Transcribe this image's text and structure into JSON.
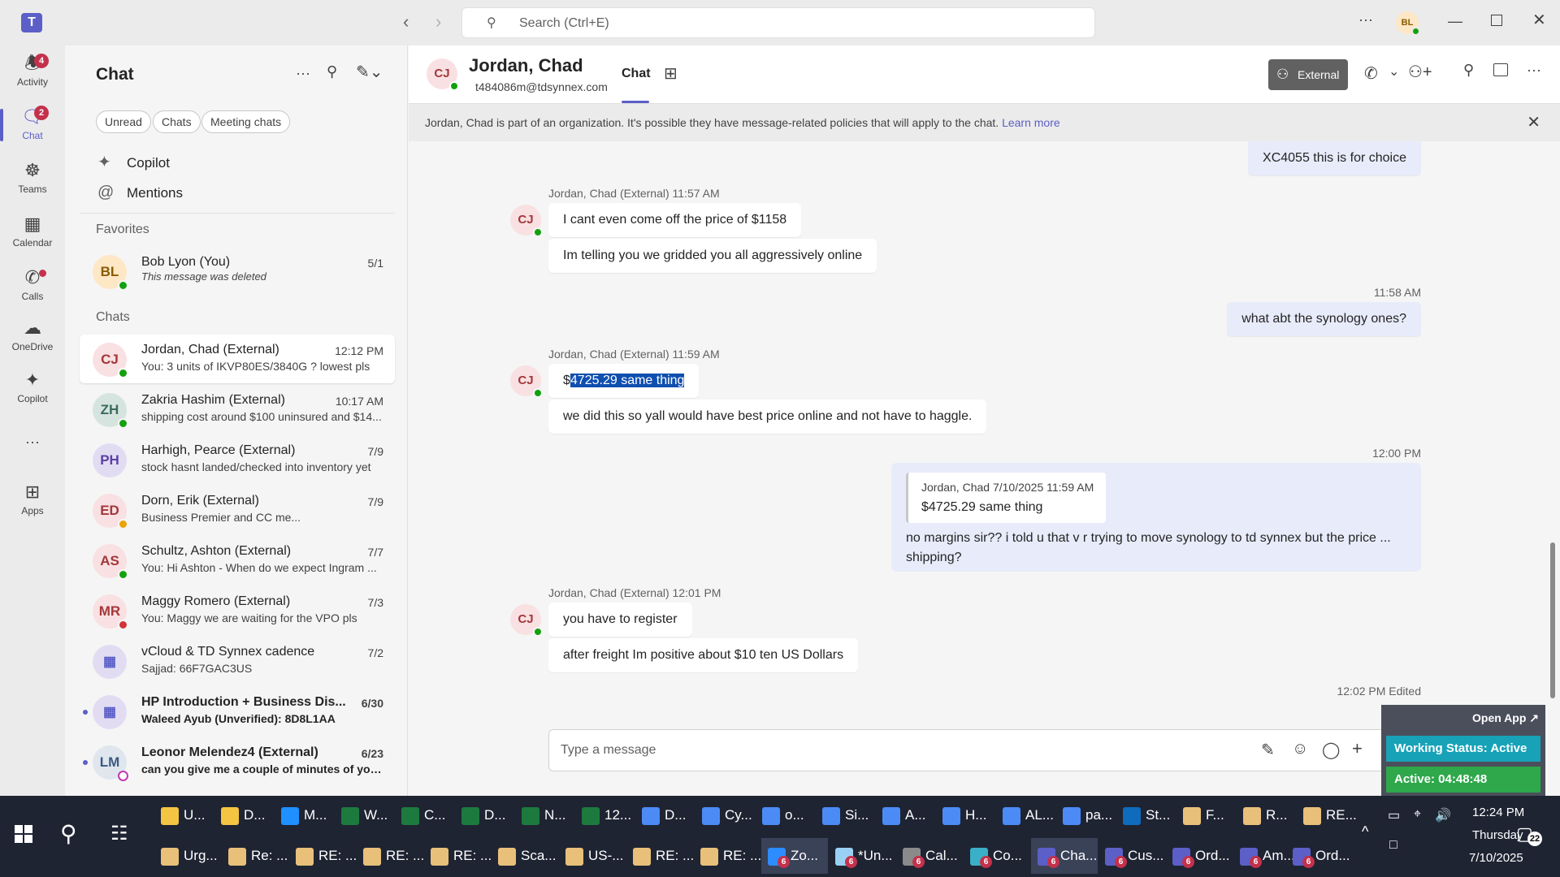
{
  "titlebar": {
    "search_placeholder": "Search (Ctrl+E)",
    "user_initials": "BL"
  },
  "rail": [
    {
      "label": "Activity",
      "icon": "bell-icon",
      "badge": "4"
    },
    {
      "label": "Chat",
      "icon": "chat-icon",
      "badge": "2"
    },
    {
      "label": "Teams",
      "icon": "teams-icon"
    },
    {
      "label": "Calendar",
      "icon": "calendar-icon"
    },
    {
      "label": "Calls",
      "icon": "phone-icon"
    },
    {
      "label": "OneDrive",
      "icon": "cloud-icon"
    },
    {
      "label": "Copilot",
      "icon": "copilot-icon"
    },
    {
      "label": "Apps",
      "icon": "plus-box-icon"
    }
  ],
  "leftpane": {
    "title": "Chat",
    "filters": [
      "Unread",
      "Chats",
      "Meeting chats"
    ],
    "nav": [
      {
        "label": "Copilot"
      },
      {
        "label": "Mentions"
      }
    ],
    "favorites_label": "Favorites",
    "chats_label": "Chats"
  },
  "favorites": [
    {
      "initials": "BL",
      "name": "Bob Lyon (You)",
      "time": "5/1",
      "preview": "This message was deleted"
    }
  ],
  "chats": [
    {
      "initials": "CJ",
      "name": "Jordan, Chad",
      "tag": "(External)",
      "time": "12:12 PM",
      "preview": "You: 3 units of IKVP80ES/3840G ? lowest pls"
    },
    {
      "initials": "ZH",
      "name": "Zakria Hashim",
      "tag": "(External)",
      "time": "10:17 AM",
      "preview": "shipping cost around $100 uninsured and $14..."
    },
    {
      "initials": "PH",
      "name": "Harhigh, Pearce",
      "tag": "(External)",
      "time": "7/9",
      "preview": "stock hasnt landed/checked into inventory yet"
    },
    {
      "initials": "ED",
      "name": "Dorn, Erik",
      "tag": "(External)",
      "time": "7/9",
      "preview": "Business Premier and CC me..."
    },
    {
      "initials": "AS",
      "name": "Schultz, Ashton",
      "tag": "(External)",
      "time": "7/7",
      "preview": "You: Hi Ashton -  When do we expect Ingram ..."
    },
    {
      "initials": "MR",
      "name": "Maggy Romero",
      "tag": "(External)",
      "time": "7/3",
      "preview": "You: Maggy we are waiting for the VPO pls"
    },
    {
      "initials": "",
      "name": "vCloud & TD Synnex cadence",
      "tag": "",
      "time": "7/2",
      "preview": "Sajjad: 66F7GAC3US"
    },
    {
      "initials": "",
      "name": "HP Introduction + Business Dis...",
      "tag": "",
      "time": "6/30",
      "preview": "Waleed Ayub (Unverified): 8D8L1AA"
    },
    {
      "initials": "LM",
      "name": "Leonor Melendez4",
      "tag": "(External)",
      "time": "6/23",
      "preview": "can you give me a couple of minutes of your..."
    }
  ],
  "header": {
    "initials": "CJ",
    "name": "Jordan, Chad",
    "email": "t484086m@tdsynnex.com",
    "tab": "Chat",
    "external_label": "External"
  },
  "banner": {
    "text": "Jordan, Chad is part of an organization. It's possible they have message-related policies that will apply to the chat.",
    "link": "Learn more"
  },
  "messages": {
    "m0": "XC4055   this is for choice",
    "g1_meta": "Jordan, Chad (External)   11:57 AM",
    "m1": "I cant even come off the price of $1158",
    "m2": "Im telling you we gridded you all aggressively online",
    "t1": "11:58 AM",
    "m3": "what abt the synology ones?",
    "g2_meta": "Jordan, Chad (External)   11:59 AM",
    "m4_prefix": "$",
    "m4_selected": "4725.29 same thing",
    "m5": "we did this so yall would have best price online and not have to haggle.",
    "t2": "12:00 PM",
    "quote_meta": "Jordan, Chad   7/10/2025 11:59 AM",
    "quote_text": "$4725.29 same thing",
    "m6_line1": "no margins sir?? i told u that v r trying to move synology to td synnex but the price ...",
    "m6_line2": "shipping?",
    "g3_meta": "Jordan, Chad (External)   12:01 PM",
    "m7": "you have to register",
    "m8": "after freight Im positive about $10 ten US Dollars",
    "t3": "12:02 PM   Edited"
  },
  "compose": {
    "placeholder": "Type a message"
  },
  "widget": {
    "open_app": "Open App ↗",
    "status": "Working Status: Active",
    "timer": "Active: 04:48:48"
  },
  "taskbar": {
    "row1": [
      "U...",
      "D...",
      "M...",
      "W...",
      "C...",
      "D...",
      "N...",
      "12...",
      "D...",
      "Cy...",
      "o...",
      "Si...",
      "A...",
      "H...",
      "AL...",
      "pa...",
      "St...",
      "F...",
      "R...",
      "RE..."
    ],
    "row2": [
      "Urg...",
      "Re: ...",
      "RE: ...",
      "RE: ...",
      "RE: ...",
      "Sca...",
      "US-...",
      "RE: ...",
      "RE: ...",
      "Zo...",
      "*Un...",
      "Cal...",
      "Co...",
      "Cha...",
      "Cus...",
      "Ord...",
      "Am...",
      "Ord..."
    ],
    "time": "12:24 PM",
    "day": "Thursday",
    "date": "7/10/2025",
    "notif_count": "22",
    "zoom_badge": "6"
  }
}
